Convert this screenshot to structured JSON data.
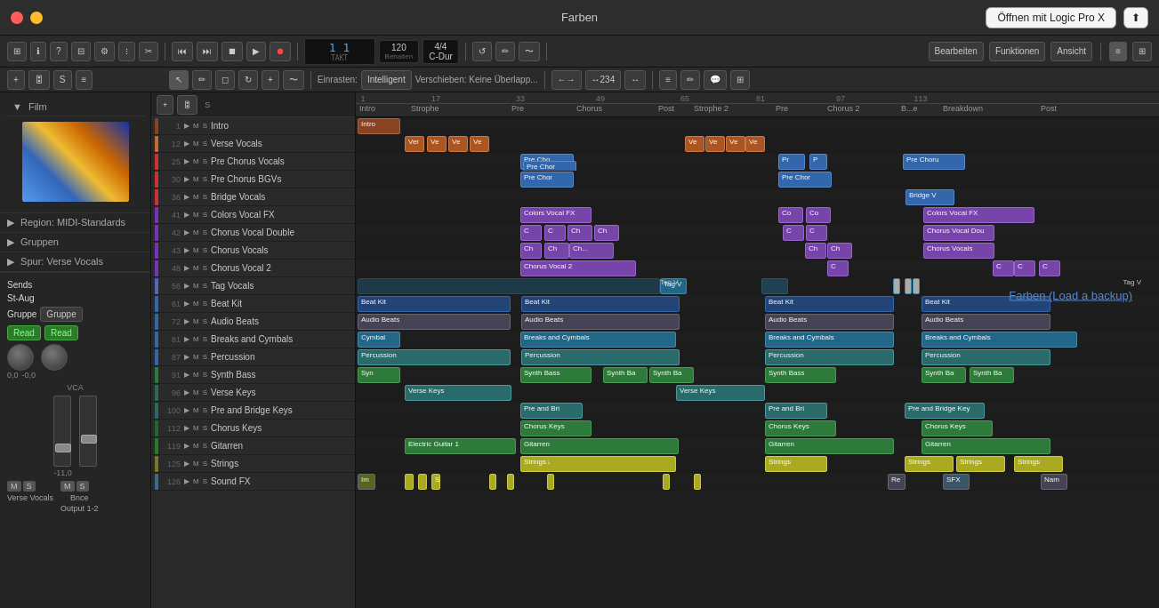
{
  "window": {
    "title": "Farben",
    "open_btn": "Öffnen mit Logic Pro X",
    "share_btn": "⬆"
  },
  "toolbar": {
    "bearbeiten": "Bearbeiten",
    "funktionen": "Funktionen",
    "ansicht": "Ansicht",
    "einrasten": "Einrasten:",
    "intelligent": "Intelligent",
    "verschieben": "Verschieben: Keine Überlapp...",
    "time_display": "1  1",
    "takt_label": "TAKT",
    "bpm": "120",
    "behalten": "Behalten",
    "signature": "4/4",
    "key": "C-Dur",
    "zoom_value": "↔234"
  },
  "sidebar": {
    "film_label": "Film",
    "region_label": "Region: MIDI-Standards",
    "gruppen_label": "Gruppen",
    "spur_label": "Spur: Verse Vocals",
    "sends_label": "Sends",
    "st_aug_label": "St-Aug",
    "gruppe_label": "Gruppe",
    "gruppe_btn": "Gruppe",
    "read_label": "Read",
    "db_value": "-11,0",
    "pan_left": "0,0",
    "pan_right": "-0,0",
    "vca_label": "VCA",
    "m_label": "M",
    "s_label": "S",
    "channel_label": "Verse Vocals",
    "output_label": "Output 1-2",
    "bnce_label": "Bnce",
    "m2_label": "M",
    "s2_label": "S"
  },
  "tracks": [
    {
      "number": "1",
      "name": "Intro",
      "color": "#884422"
    },
    {
      "number": "12",
      "name": "Verse Vocals",
      "color": "#cc6633"
    },
    {
      "number": "25",
      "name": "Pre Chorus Vocals",
      "color": "#cc3333"
    },
    {
      "number": "30",
      "name": "Pre Chorus BGVs",
      "color": "#cc3333"
    },
    {
      "number": "36",
      "name": "Bridge Vocals",
      "color": "#cc3333"
    },
    {
      "number": "41",
      "name": "Colors Vocal FX",
      "color": "#7733bb"
    },
    {
      "number": "42",
      "name": "Chorus Vocal Double",
      "color": "#7733bb"
    },
    {
      "number": "43",
      "name": "Chorus Vocals",
      "color": "#7733bb"
    },
    {
      "number": "48",
      "name": "Chorus Vocal 2",
      "color": "#7733bb"
    },
    {
      "number": "56",
      "name": "Tag Vocals",
      "color": "#5566bb"
    },
    {
      "number": "61",
      "name": "Beat Kit",
      "color": "#3366aa"
    },
    {
      "number": "72",
      "name": "Audio Beats",
      "color": "#3366aa"
    },
    {
      "number": "81",
      "name": "Breaks and Cymbals",
      "color": "#3366aa"
    },
    {
      "number": "87",
      "name": "Percussion",
      "color": "#3366aa"
    },
    {
      "number": "91",
      "name": "Synth Bass",
      "color": "#2d7a3a"
    },
    {
      "number": "96",
      "name": "Verse Keys",
      "color": "#2d6a4a"
    },
    {
      "number": "100",
      "name": "Pre and Bridge Keys",
      "color": "#2a6a6a"
    },
    {
      "number": "112",
      "name": "Chorus Keys",
      "color": "#226633"
    },
    {
      "number": "119",
      "name": "Gitarren",
      "color": "#2a7a2a"
    },
    {
      "number": "125",
      "name": "Strings",
      "color": "#7a7a22"
    },
    {
      "number": "126",
      "name": "Sound FX",
      "color": "#446688"
    }
  ],
  "sections": [
    {
      "label": "Intro",
      "pos": 0
    },
    {
      "label": "Strophe",
      "pos": 80
    },
    {
      "label": "Pre",
      "pos": 185
    },
    {
      "label": "Chorus",
      "pos": 270
    },
    {
      "label": "Post",
      "pos": 365
    },
    {
      "label": "Strophe 2",
      "pos": 410
    },
    {
      "label": "Pre",
      "pos": 500
    },
    {
      "label": "Chorus 2",
      "pos": 565
    },
    {
      "label": "B...e",
      "pos": 640
    },
    {
      "label": "Breakdown",
      "pos": 700
    },
    {
      "label": "Post",
      "pos": 800
    }
  ],
  "farben_backup": "Farben (Load a backup)"
}
